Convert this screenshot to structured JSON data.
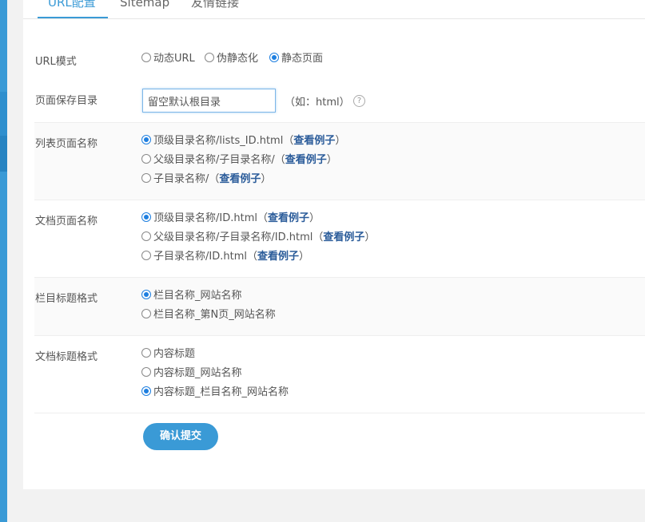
{
  "tabs": [
    {
      "label": "URL配置",
      "active": true
    },
    {
      "label": "Sitemap",
      "active": false
    },
    {
      "label": "友情链接",
      "active": false
    }
  ],
  "form": {
    "url_mode": {
      "label": "URL模式",
      "options": [
        {
          "label": "动态URL",
          "checked": false
        },
        {
          "label": "伪静态化",
          "checked": false
        },
        {
          "label": "静态页面",
          "checked": true
        }
      ]
    },
    "save_dir": {
      "label": "页面保存目录",
      "value": "留空默认根目录",
      "hint": "（如：html）"
    },
    "list_page_name": {
      "label": "列表页面名称",
      "options": [
        {
          "label": "顶级目录名称/lists_ID.html（",
          "link": "查看例子",
          "tail": "）",
          "checked": true
        },
        {
          "label": "父级目录名称/子目录名称/（",
          "link": "查看例子",
          "tail": "）",
          "checked": false
        },
        {
          "label": "子目录名称/（",
          "link": "查看例子",
          "tail": "）",
          "checked": false
        }
      ]
    },
    "doc_page_name": {
      "label": "文档页面名称",
      "options": [
        {
          "label": "顶级目录名称/ID.html（",
          "link": "查看例子",
          "tail": "）",
          "checked": true
        },
        {
          "label": "父级目录名称/子目录名称/ID.html（",
          "link": "查看例子",
          "tail": "）",
          "checked": false
        },
        {
          "label": "子目录名称/ID.html（",
          "link": "查看例子",
          "tail": "）",
          "checked": false
        }
      ]
    },
    "column_title_format": {
      "label": "栏目标题格式",
      "options": [
        {
          "label": "栏目名称_网站名称",
          "checked": true
        },
        {
          "label": "栏目名称_第N页_网站名称",
          "checked": false
        }
      ]
    },
    "doc_title_format": {
      "label": "文档标题格式",
      "options": [
        {
          "label": "内容标题",
          "checked": false
        },
        {
          "label": "内容标题_网站名称",
          "checked": false
        },
        {
          "label": "内容标题_栏目名称_网站名称",
          "checked": true
        }
      ]
    },
    "submit_label": "确认提交"
  },
  "colors": {
    "accent": "#3a9ad6",
    "radio": "#1e7fe0",
    "link": "#2b5c9a"
  },
  "icons": {
    "help": "question-circle-icon",
    "help_glyph": "?"
  }
}
